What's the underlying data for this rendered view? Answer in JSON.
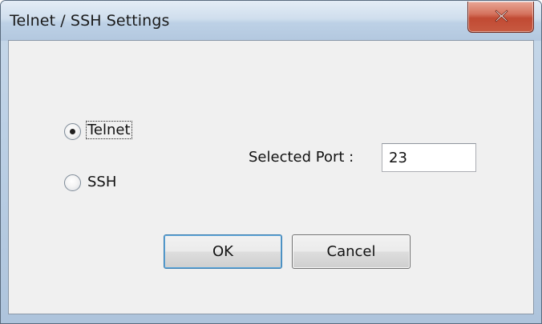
{
  "window": {
    "title": "Telnet / SSH Settings",
    "close_icon": "close-icon"
  },
  "protocol": {
    "options": [
      {
        "label": "Telnet",
        "selected": true
      },
      {
        "label": "SSH",
        "selected": false
      }
    ]
  },
  "port": {
    "label": "Selected Port :",
    "value": "23"
  },
  "buttons": {
    "ok_label": "OK",
    "cancel_label": "Cancel"
  },
  "colors": {
    "close_button": "#c75a41",
    "client_background": "#f0f0f0"
  }
}
